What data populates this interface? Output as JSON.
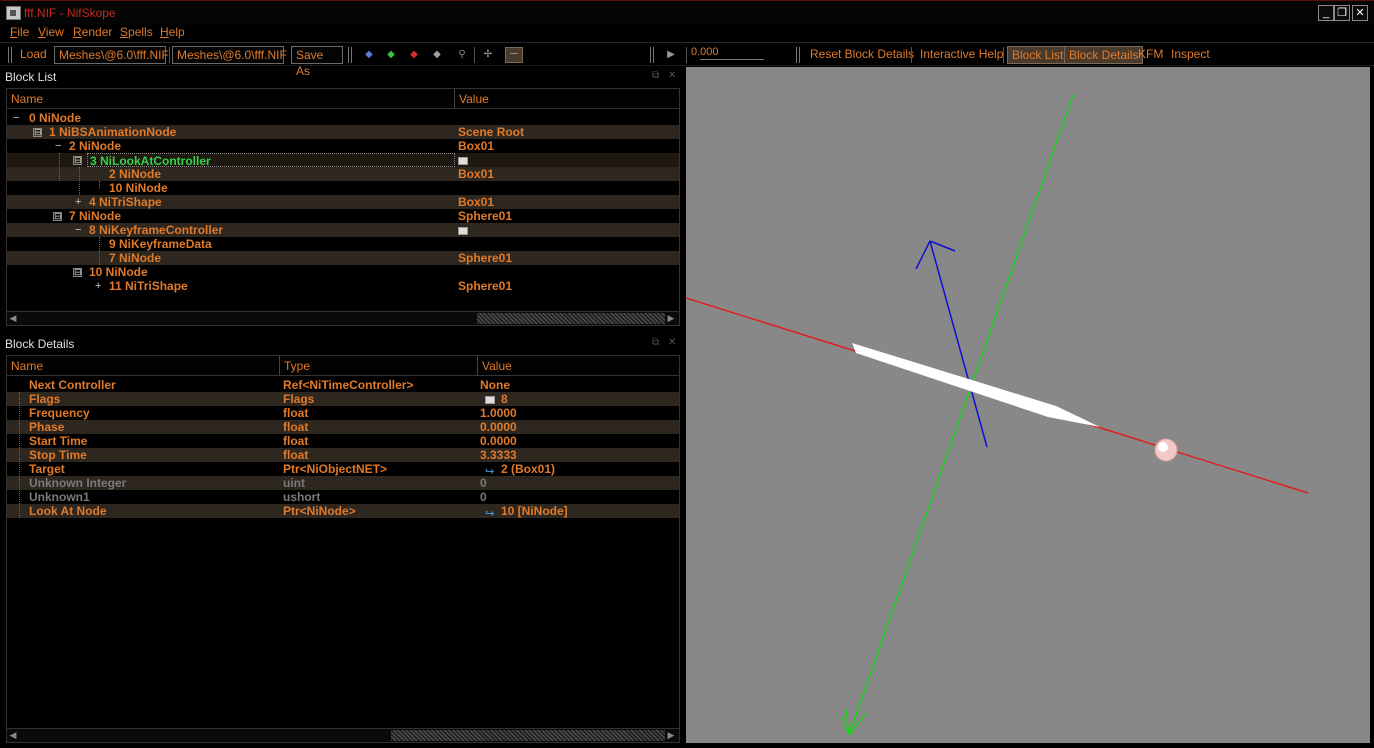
{
  "window": {
    "title": "fff.NIF - NifSkope",
    "buttons": {
      "minimize": "_",
      "restore": "❐",
      "close": "✕"
    }
  },
  "menu": {
    "items": [
      {
        "accel": "F",
        "rest": "ile"
      },
      {
        "accel": "V",
        "rest": "iew"
      },
      {
        "accel": "R",
        "rest": "ender"
      },
      {
        "accel": "S",
        "rest": "pells"
      },
      {
        "accel": "H",
        "rest": "elp"
      }
    ]
  },
  "toolbar": {
    "load_label": "Load",
    "load_path": "Meshes\\@6.0\\fff.NIF",
    "save_path": "Meshes\\@6.0\\fff.NIF",
    "save_as_label": "Save As",
    "time_value": "0.000",
    "reset_block_details": "Reset Block Details",
    "interactive_help": "Interactive Help",
    "block_list": "Block List",
    "block_details": "Block Details",
    "kfm": "KFM",
    "inspect": "Inspect"
  },
  "block_list": {
    "title": "Block List",
    "columns": [
      "Name",
      "Value"
    ],
    "rows": [
      {
        "expander": "−",
        "name": "0 NiNode",
        "value": ""
      },
      {
        "expander": "⊟",
        "name": "1 NiBSAnimationNode",
        "value": "Scene Root"
      },
      {
        "expander": "−",
        "name": "2 NiNode",
        "value": "Box01"
      },
      {
        "expander": "⊟",
        "name": "3 NiLookAtController",
        "value": ""
      },
      {
        "expander": "",
        "name": "2 NiNode",
        "value": "Box01"
      },
      {
        "expander": "",
        "name": "10 NiNode",
        "value": ""
      },
      {
        "expander": "+",
        "name": "4 NiTriShape",
        "value": "Box01"
      },
      {
        "expander": "⊟",
        "name": "7 NiNode",
        "value": "Sphere01"
      },
      {
        "expander": "−",
        "name": "8 NiKeyframeController",
        "value": ""
      },
      {
        "expander": "",
        "name": "9 NiKeyframeData",
        "value": ""
      },
      {
        "expander": "",
        "name": "7 NiNode",
        "value": "Sphere01"
      },
      {
        "expander": "⊟",
        "name": "10 NiNode",
        "value": ""
      },
      {
        "expander": "+",
        "name": "11 NiTriShape",
        "value": "Sphere01"
      }
    ]
  },
  "block_details": {
    "title": "Block Details",
    "columns": [
      "Name",
      "Type",
      "Value"
    ],
    "rows": [
      {
        "name": "Next Controller",
        "type": "Ref<NiTimeController>",
        "value": "None"
      },
      {
        "name": "Flags",
        "type": "Flags",
        "value": "8"
      },
      {
        "name": "Frequency",
        "type": "float",
        "value": "1.0000"
      },
      {
        "name": "Phase",
        "type": "float",
        "value": "0.0000"
      },
      {
        "name": "Start Time",
        "type": "float",
        "value": "0.0000"
      },
      {
        "name": "Stop Time",
        "type": "float",
        "value": "3.3333"
      },
      {
        "name": "Target",
        "type": "Ptr<NiObjectNET>",
        "value": "2 (Box01)"
      },
      {
        "name": "Unknown Integer",
        "type": "uint",
        "value": "0"
      },
      {
        "name": "Unknown1",
        "type": "ushort",
        "value": "0"
      },
      {
        "name": "Look At Node",
        "type": "Ptr<NiNode>",
        "value": "10 [NiNode]"
      }
    ]
  },
  "colors": {
    "accent": "#e07a2a",
    "selected_text": "#35d24a",
    "viewport_bg": "#888888",
    "axis_x": "#e02020",
    "axis_y": "#20d020",
    "axis_z": "#1010d0"
  }
}
